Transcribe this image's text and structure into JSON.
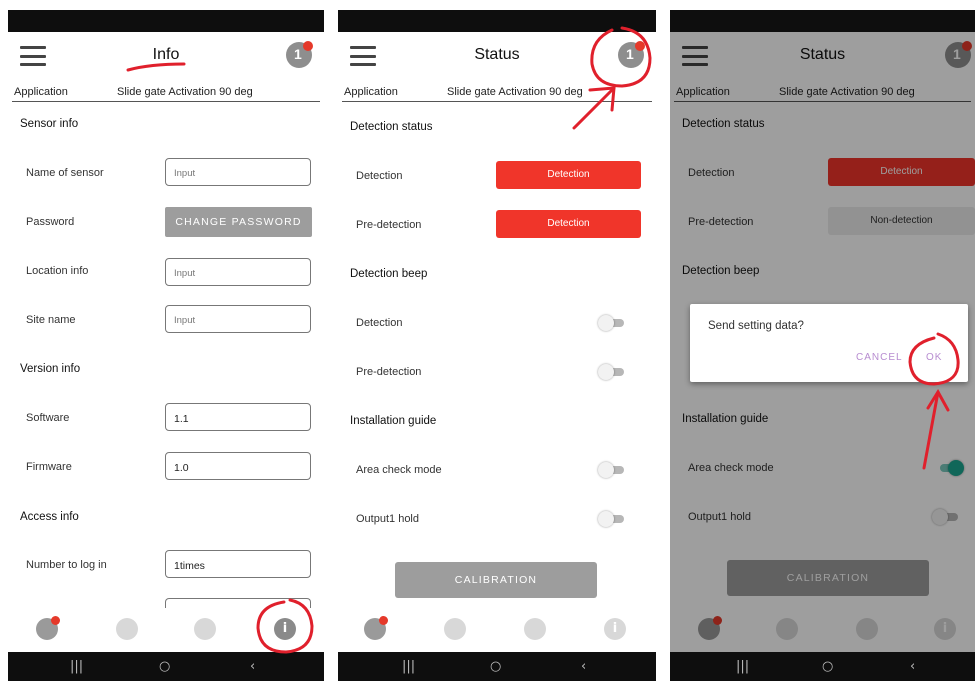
{
  "colors": {
    "accent_red": "#f0352a",
    "toggle_on": "#1aa690",
    "dialog_action": "#b78cd0",
    "annotation": "#e0202c"
  },
  "screen1": {
    "title": "Info",
    "application_label": "Application",
    "application_value": "Slide gate Activation 90 deg",
    "sensor_info": {
      "section": "Sensor info",
      "name_label": "Name of sensor",
      "name_placeholder": "Input",
      "password_label": "Password",
      "change_password": "CHANGE PASSWORD",
      "location_label": "Location info",
      "location_placeholder": "Input",
      "site_label": "Site name",
      "site_placeholder": "Input"
    },
    "version_info": {
      "section": "Version info",
      "software_label": "Software",
      "software_value": "1.1",
      "firmware_label": "Firmware",
      "firmware_value": "1.0"
    },
    "access_info": {
      "section": "Access info",
      "login_label": "Number to log in",
      "login_value": "1times"
    }
  },
  "screen2": {
    "title": "Status",
    "application_label": "Application",
    "application_value": "Slide gate Activation 90 deg",
    "detection_status": {
      "section": "Detection status",
      "detection_label": "Detection",
      "detection_value": "Detection",
      "predetection_label": "Pre-detection",
      "predetection_value": "Detection"
    },
    "detection_beep": {
      "section": "Detection beep",
      "detection_label": "Detection",
      "detection_on": false,
      "predetection_label": "Pre-detection",
      "predetection_on": false
    },
    "installation_guide": {
      "section": "Installation guide",
      "area_check_label": "Area check mode",
      "area_check_on": false,
      "output1_label": "Output1 hold",
      "output1_on": false
    },
    "calibration": "CALIBRATION"
  },
  "screen3": {
    "title": "Status",
    "application_label": "Application",
    "application_value": "Slide gate Activation 90 deg",
    "detection_status": {
      "section": "Detection status",
      "detection_label": "Detection",
      "detection_value": "Detection",
      "predetection_label": "Pre-detection",
      "predetection_value": "Non-detection"
    },
    "detection_beep": {
      "section": "Detection beep"
    },
    "installation_guide": {
      "section": "Installation guide",
      "area_check_label": "Area check mode",
      "area_check_on": true,
      "output1_label": "Output1 hold",
      "output1_on": false
    },
    "calibration": "CALIBRATION",
    "dialog": {
      "message": "Send setting data?",
      "cancel": "CANCEL",
      "ok": "OK"
    }
  },
  "bottom_nav": {
    "items": [
      "status-icon",
      "settings-gear-icon",
      "sync-icon",
      "info-icon"
    ]
  },
  "system_nav": {
    "recents": "|||",
    "home": "○",
    "back": "‹"
  }
}
